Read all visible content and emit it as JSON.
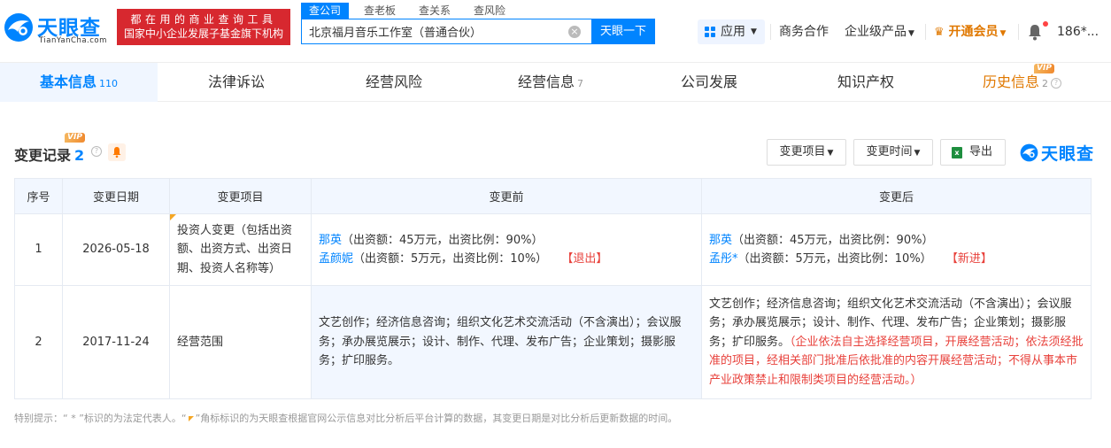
{
  "header": {
    "logo_title": "天眼查",
    "logo_sub": "TianYanCha.com",
    "promo_line1": "都在用的商业查询工具",
    "promo_line2": "国家中小企业发展子基金旗下机构",
    "search_tabs": [
      "查公司",
      "查老板",
      "查关系",
      "查风险"
    ],
    "search_value": "北京福月音乐工作室（普通合伙）",
    "search_button": "天眼一下",
    "apps_label": "应用",
    "nav_business": "商务合作",
    "nav_enterprise": "企业级产品",
    "nav_vip": "开通会员",
    "user_label": "186*..."
  },
  "tabs": [
    {
      "label": "基本信息",
      "count": "110"
    },
    {
      "label": "法律诉讼",
      "count": ""
    },
    {
      "label": "经营风险",
      "count": ""
    },
    {
      "label": "经营信息",
      "count": "7"
    },
    {
      "label": "公司发展",
      "count": ""
    },
    {
      "label": "知识产权",
      "count": ""
    },
    {
      "label": "历史信息",
      "count": "2"
    }
  ],
  "vip_text": "VIP",
  "section": {
    "title": "变更记录",
    "count": "2",
    "filter_item": "变更项目",
    "filter_time": "变更时间",
    "export": "导出",
    "watermark": "天眼查"
  },
  "table": {
    "headers": [
      "序号",
      "变更日期",
      "变更项目",
      "变更前",
      "变更后"
    ],
    "rows": [
      {
        "index": "1",
        "date": "2026-05-18",
        "item": "投资人变更（包括出资额、出资方式、出资日期、投资人名称等）",
        "before": [
          {
            "name": "那英",
            "detail": "（出资额：45万元，出资比例：90%）",
            "tag": ""
          },
          {
            "name": "孟颜妮",
            "detail": "（出资额：5万元，出资比例：10%）",
            "tag": "【退出】"
          }
        ],
        "after": [
          {
            "name": "那英",
            "detail": "（出资额：45万元，出资比例：90%）",
            "tag": ""
          },
          {
            "name": "孟彤*",
            "detail": "（出资额：5万元，出资比例：10%）",
            "tag": "【新进】"
          }
        ]
      },
      {
        "index": "2",
        "date": "2017-11-24",
        "item": "经营范围",
        "before": "文艺创作；经济信息咨询；组织文化艺术交流活动（不含演出）；会议服务；承办展览展示；设计、制作、代理、发布广告；企业策划；摄影服务；扩印服务。",
        "after_main": "文艺创作；经济信息咨询；组织文化艺术交流活动（不含演出）；会议服务；承办展览展示；设计、制作、代理、发布广告；企业策划；摄影服务；扩印服务。",
        "after_note": "（企业依法自主选择经营项目，开展经营活动；依法须经批准的项目，经相关部门批准后依批准的内容开展经营活动；不得从事本市产业政策禁止和限制类项目的经营活动。）"
      }
    ]
  },
  "note_part1": "特别提示：“ * ”标识的为法定代表人。“",
  "note_part2": "”角标标识的为天眼查根据官网公示信息对比分析后平台计算的数据，其变更日期是对比分析后更新数据的时间。",
  "colors": {
    "primary": "#0084ff",
    "promo": "#d7282f",
    "warning": "#e8413b",
    "vip": "#e07800"
  }
}
